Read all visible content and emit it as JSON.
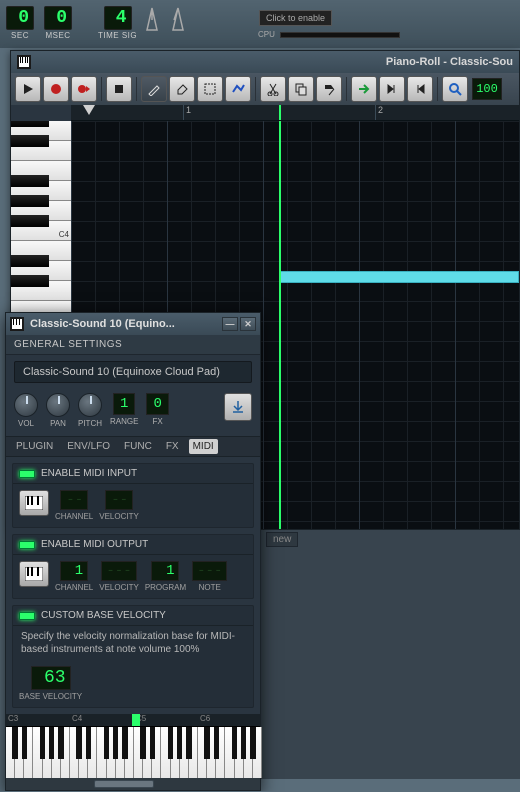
{
  "transport": {
    "sec": {
      "value": "0",
      "label": "SEC"
    },
    "msec": {
      "value": "0",
      "label": "MSEC"
    },
    "timesig": {
      "value": "4",
      "label": "TIME SIG"
    },
    "cpu_hint": "Click to enable",
    "cpu_label": "CPU"
  },
  "piano_roll": {
    "title": "Piano-Roll - Classic-Sou",
    "zoom": "100",
    "ruler_marks": [
      "1",
      "2"
    ],
    "key_label": "C4"
  },
  "instrument": {
    "title": "Classic-Sound 10 (Equino...",
    "general_header": "GENERAL SETTINGS",
    "preset": "Classic-Sound 10 (Equinoxe Cloud Pad)",
    "knobs": {
      "vol": "VOL",
      "pan": "PAN",
      "pitch": "PITCH"
    },
    "range": {
      "value": "1",
      "label": "RANGE"
    },
    "fx": {
      "value": "0",
      "label": "FX"
    },
    "tabs": [
      "PLUGIN",
      "ENV/LFO",
      "FUNC",
      "FX",
      "MIDI"
    ],
    "active_tab": 4,
    "midi_input": {
      "header": "ENABLE MIDI INPUT",
      "channel": {
        "value": "--",
        "label": "CHANNEL"
      },
      "velocity": {
        "value": "--",
        "label": "VELOCITY"
      }
    },
    "midi_output": {
      "header": "ENABLE MIDI OUTPUT",
      "channel": {
        "value": "1",
        "label": "CHANNEL"
      },
      "velocity": {
        "value": "---",
        "label": "VELOCITY"
      },
      "program": {
        "value": "1",
        "label": "PROGRAM"
      },
      "note": {
        "value": "---",
        "label": "NOTE"
      }
    },
    "custom_velocity": {
      "header": "CUSTOM BASE VELOCITY",
      "desc": "Specify the velocity normalization base for MIDI-based instruments at note volume 100%",
      "value": "63",
      "label": "BASE VELOCITY"
    },
    "mini_ruler": [
      "C3",
      "C4",
      "C5",
      "C6"
    ]
  },
  "bottom": {
    "tab": "new"
  }
}
